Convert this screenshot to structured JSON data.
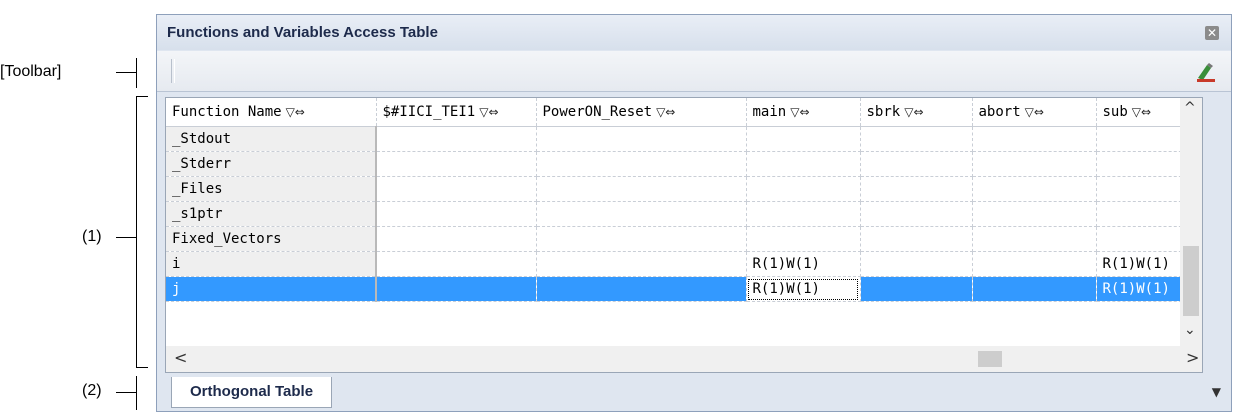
{
  "annotations": {
    "toolbar": "[Toolbar]",
    "area1": "(1)",
    "area2": "(2)"
  },
  "panel": {
    "title": "Functions and Variables Access Table",
    "close_icon": "close-icon",
    "toolbar_icon": "highlight-icon"
  },
  "grid": {
    "columns": [
      "Function Name",
      "$#IICI_TEI1",
      "PowerON_Reset",
      "main",
      "sbrk",
      "abort",
      "sub"
    ],
    "filter_glyph": "▽⇔",
    "rows": [
      {
        "name": "_Stdout",
        "cells": [
          "",
          "",
          "",
          "",
          "",
          ""
        ]
      },
      {
        "name": "_Stderr",
        "cells": [
          "",
          "",
          "",
          "",
          "",
          ""
        ]
      },
      {
        "name": "_Files",
        "cells": [
          "",
          "",
          "",
          "",
          "",
          ""
        ]
      },
      {
        "name": "_s1ptr",
        "cells": [
          "",
          "",
          "",
          "",
          "",
          ""
        ]
      },
      {
        "name": "Fixed_Vectors",
        "cells": [
          "",
          "",
          "",
          "",
          "",
          ""
        ]
      },
      {
        "name": "i",
        "cells": [
          "",
          "",
          "R(1)W(1)",
          "",
          "",
          "R(1)W(1)"
        ]
      },
      {
        "name": "j",
        "cells": [
          "",
          "",
          "R(1)W(1)",
          "",
          "",
          "R(1)W(1)"
        ]
      }
    ],
    "selected_row": 6
  },
  "scroll": {
    "up": "^",
    "down": "⌄",
    "left": "<",
    "right": ">"
  },
  "tabs": {
    "active": "Orthogonal Table",
    "menu": "▼"
  }
}
